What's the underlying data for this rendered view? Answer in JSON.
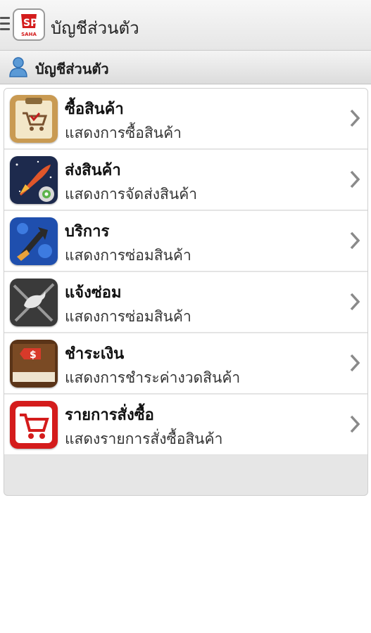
{
  "appbar": {
    "title": "บัญชีส่วนตัว",
    "logo_text": "SAHA",
    "menu_icon": "hamburger-icon"
  },
  "section": {
    "title": "บัญชีส่วนตัว",
    "icon": "user-icon"
  },
  "menu": {
    "items": [
      {
        "title": "ซื้อสินค้า",
        "subtitle": "แสดงการซื้อสินค้า",
        "icon": "shopping-basket-clipboard-icon"
      },
      {
        "title": "ส่งสินค้า",
        "subtitle": "แสดงการจัดส่งสินค้า",
        "icon": "rocket-icon"
      },
      {
        "title": "บริการ",
        "subtitle": "แสดงการซ่อมสินค้า",
        "icon": "service-tool-icon"
      },
      {
        "title": "แจ้งซ่อม",
        "subtitle": "แสดงการซ่อมสินค้า",
        "icon": "bird-repair-icon"
      },
      {
        "title": "ชำระเงิน",
        "subtitle": "แสดงการชำระค่างวดสินค้า",
        "icon": "payment-book-icon"
      },
      {
        "title": "รายการสั่งซื้อ",
        "subtitle": "แสดงรายการสั่งซื้อสินค้า",
        "icon": "red-cart-icon"
      }
    ]
  },
  "colors": {
    "brand_red": "#d41c1c",
    "chevron": "#8a8a8a"
  }
}
